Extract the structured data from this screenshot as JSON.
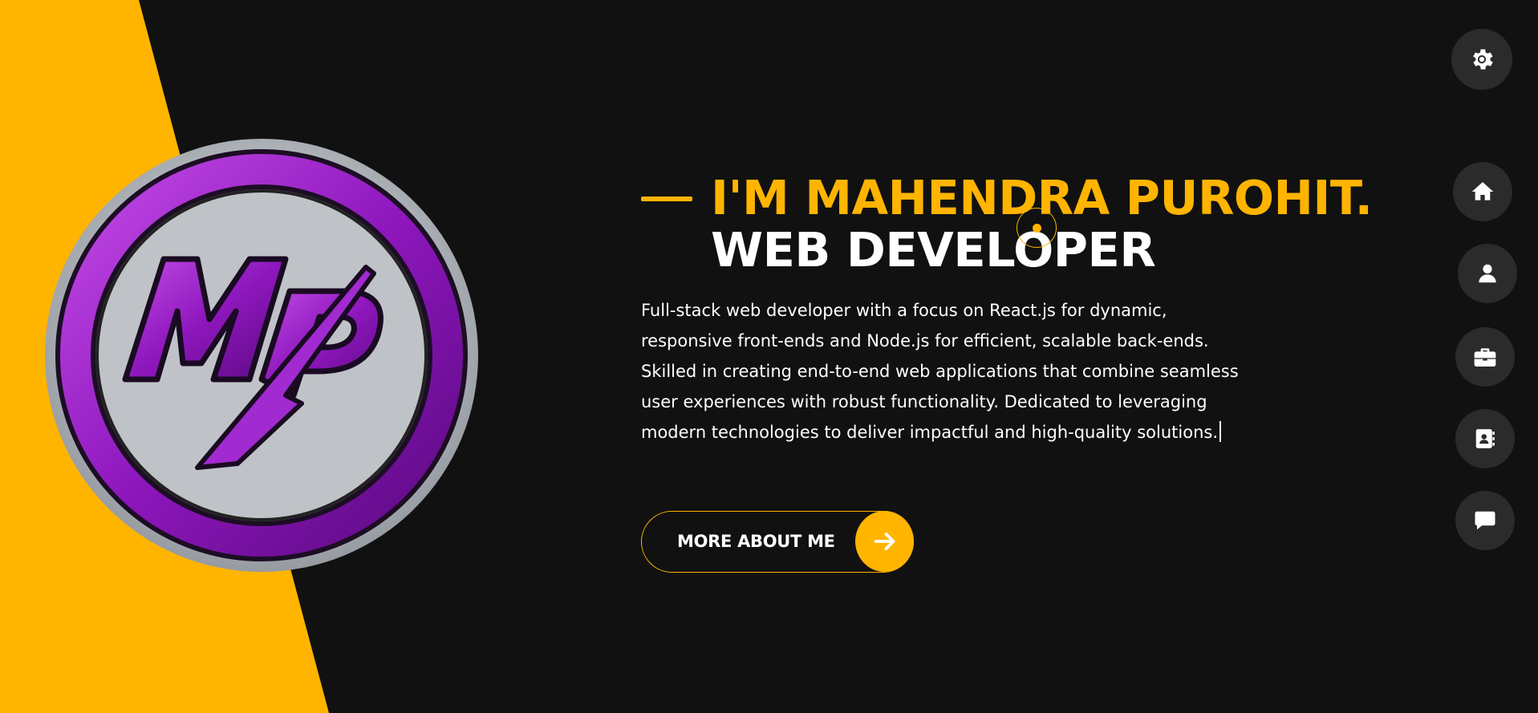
{
  "colors": {
    "accent": "#ffb400",
    "background": "#111111",
    "nav_button": "#2b2b2b",
    "text": "#ffffff",
    "logo_purple": "#9a1fc4",
    "logo_silver": "#b8bcc0"
  },
  "logo": {
    "text": "MP",
    "icon": "mp-monogram-logo"
  },
  "theme_toggle": {
    "icon": "gear-icon"
  },
  "nav": {
    "items": [
      {
        "id": "home",
        "icon": "home-icon"
      },
      {
        "id": "about",
        "icon": "user-icon"
      },
      {
        "id": "portfolio",
        "icon": "briefcase-icon"
      },
      {
        "id": "contact",
        "icon": "address-book-icon"
      },
      {
        "id": "blog",
        "icon": "chat-bubble-icon"
      }
    ]
  },
  "hero": {
    "title_line1": "I'M MAHENDRA PUROHIT.",
    "title_line2": "WEB DEVELOPER",
    "intro": "Full-stack web developer with a focus on React.js for dynamic, responsive front-ends and Node.js for efficient, scalable back-ends. Skilled in creating end-to-end web applications that combine seamless user experiences with robust functionality. Dedicated to leveraging modern technologies to deliver impactful and high-quality solutions.",
    "cta_label": "MORE ABOUT ME",
    "cta_icon": "arrow-right-icon"
  }
}
